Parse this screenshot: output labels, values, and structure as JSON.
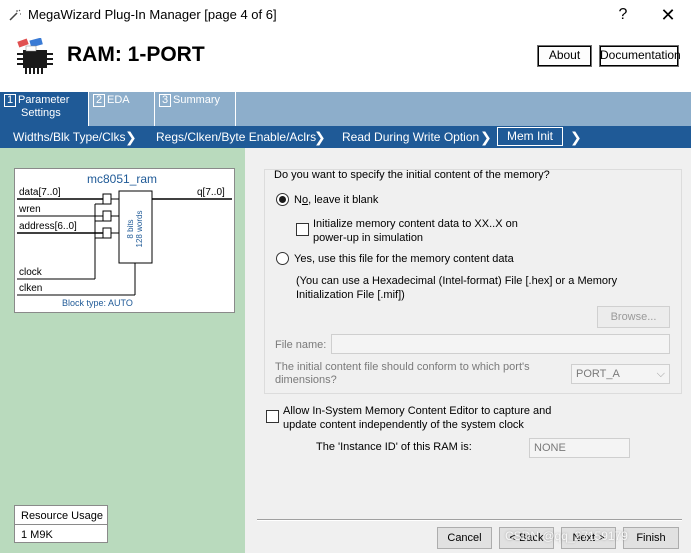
{
  "window": {
    "title": "MegaWizard Plug-In Manager [page 4 of 6]",
    "help_glyph": "?",
    "close_glyph": "✕",
    "icon": "wand-icon"
  },
  "header": {
    "title": "RAM: 1-PORT",
    "about_label": "About",
    "documentation_label": "Documentation",
    "icon": "chip-icon"
  },
  "tabs": [
    {
      "num": "1",
      "label_line1": "Parameter",
      "label_line2": "Settings"
    },
    {
      "num": "2",
      "label_line1": "EDA",
      "label_line2": ""
    },
    {
      "num": "3",
      "label_line1": "Summary",
      "label_line2": ""
    }
  ],
  "steps": [
    {
      "label": "Widths/Blk Type/Clks"
    },
    {
      "label": "Regs/Clken/Byte Enable/Aclrs"
    },
    {
      "label": "Read During Write Option"
    },
    {
      "label": "Mem Init"
    }
  ],
  "block": {
    "name": "mc8051_ram",
    "ports_in": [
      "data[7..0]",
      "wren",
      "address[6..0]",
      "clock",
      "clken"
    ],
    "port_out": "q[7..0]",
    "mem_line1": "8 bits",
    "mem_line2": "128 words",
    "block_type": "Block type: AUTO"
  },
  "resource": {
    "label": "Resource Usage",
    "value": "1 M9K"
  },
  "mem_init": {
    "question": "Do you want to specify the initial content of the memory?",
    "option_no_prefix": "N",
    "option_no_underline": "o",
    "option_no_suffix": ", leave it blank",
    "init_xx_line1": "Initialize memory content data to XX..X on",
    "init_xx_line2": "power-up in simulation",
    "option_yes": "Yes, use this file for the memory content data",
    "hex_line1": "(You can use a Hexadecimal (Intel-format) File [.hex] or a Memory",
    "hex_line2": "Initialization File [.mif])",
    "browse_label": "Browse...",
    "file_name_label": "File name:",
    "file_name_value": "",
    "conform_line1": "The initial content file should conform to which port's",
    "conform_line2": "dimensions?",
    "port_select_value": "PORT_A"
  },
  "in_system": {
    "line1": "Allow In-System Memory Content Editor to capture and",
    "line2": "update content independently of the system clock",
    "instance_label": "The 'Instance ID' of this RAM is:",
    "instance_value": "NONE"
  },
  "footer": {
    "cancel_label": "Cancel",
    "back_label": "< Back",
    "next_label": "Next >",
    "finish_label": "Finish",
    "watermark": "CSDN @qq_27159179"
  },
  "selection": {
    "selected_option": "no",
    "init_xx_checked": false,
    "in_system_checked": false
  }
}
